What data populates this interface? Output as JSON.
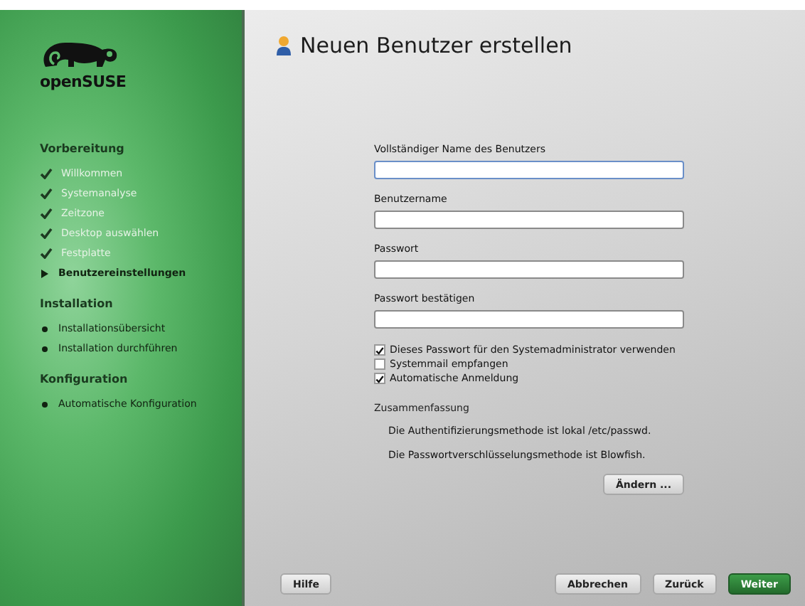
{
  "logo": {
    "text": "openSUSE"
  },
  "sidebar": {
    "sections": [
      {
        "title": "Vorbereitung",
        "items": [
          {
            "label": "Willkommen",
            "kind": "done"
          },
          {
            "label": "Systemanalyse",
            "kind": "done"
          },
          {
            "label": "Zeitzone",
            "kind": "done"
          },
          {
            "label": "Desktop auswählen",
            "kind": "done"
          },
          {
            "label": "Festplatte",
            "kind": "done"
          },
          {
            "label": "Benutzereinstellungen",
            "kind": "current"
          }
        ]
      },
      {
        "title": "Installation",
        "items": [
          {
            "label": "Installationsübersicht",
            "kind": "pending"
          },
          {
            "label": "Installation durchführen",
            "kind": "pending"
          }
        ]
      },
      {
        "title": "Konfiguration",
        "items": [
          {
            "label": "Automatische Konfiguration",
            "kind": "pending"
          }
        ]
      }
    ]
  },
  "page": {
    "title": "Neuen Benutzer erstellen"
  },
  "fields": [
    {
      "label": "Vollständiger Name des Benutzers",
      "focused": true
    },
    {
      "label": "Benutzername",
      "focused": false
    },
    {
      "label": "Passwort",
      "focused": false
    },
    {
      "label": "Passwort bestätigen",
      "focused": false
    }
  ],
  "checkboxes": [
    {
      "label": "Dieses Passwort für den Systemadministrator verwenden",
      "checked": true
    },
    {
      "label": "Systemmail empfangen",
      "checked": false
    },
    {
      "label": "Automatische Anmeldung",
      "checked": true
    }
  ],
  "summary": {
    "title": "Zusammenfassung",
    "lines": [
      "Die Authentifizierungsmethode ist lokal /etc/passwd.",
      "Die Passwortverschlüsselungsmethode ist Blowfish."
    ],
    "button": "Ändern ..."
  },
  "buttons": {
    "help": "Hilfe",
    "actions": [
      {
        "label": "Abbrechen",
        "kind": "normal"
      },
      {
        "label": "Zurück",
        "kind": "normal"
      },
      {
        "label": "Weiter",
        "kind": "primary"
      }
    ]
  }
}
